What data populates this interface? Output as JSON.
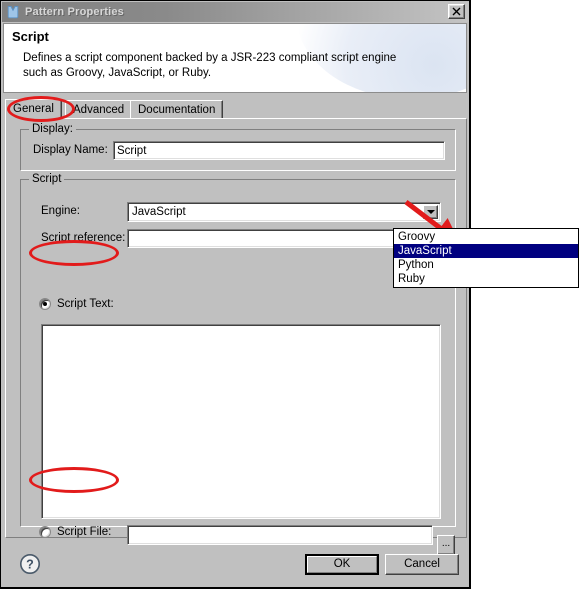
{
  "window": {
    "title": "Pattern Properties",
    "icon": "vest-icon",
    "close_label": "✕"
  },
  "header": {
    "title": "Script",
    "description": "Defines a script component backed by a JSR-223 compliant script engine such as Groovy, JavaScript, or Ruby."
  },
  "tabs": [
    {
      "label": "General",
      "selected": true
    },
    {
      "label": "Advanced",
      "selected": false
    },
    {
      "label": "Documentation",
      "selected": false
    }
  ],
  "display_group": {
    "title": "Display:",
    "display_name_label": "Display Name:",
    "display_name_value": "Script",
    "display_name_placeholder": ""
  },
  "script_group": {
    "title": "Script",
    "engine_label": "Engine:",
    "engine_value": "JavaScript",
    "engine_options": [
      "Groovy",
      "JavaScript",
      "Python",
      "Ruby"
    ],
    "engine_selected_option": "JavaScript",
    "script_reference_label": "Script reference:",
    "script_reference_value": "",
    "script_reference_placeholder": "",
    "script_text_label": "Script Text:",
    "script_text_value": "",
    "script_file_label": "Script File:",
    "script_file_value": "",
    "script_file_placeholder": "",
    "browse_label": "...",
    "selected_source": "Script Text:"
  },
  "footer": {
    "help_label": "?",
    "ok_label": "OK",
    "cancel_label": "Cancel"
  },
  "annotations": {
    "accent_color": "#e21b1b",
    "highlight_color": "#000080",
    "marked_items": [
      "General",
      "Script Text:",
      "Script File:",
      "engine-dropdown-arrow"
    ]
  }
}
